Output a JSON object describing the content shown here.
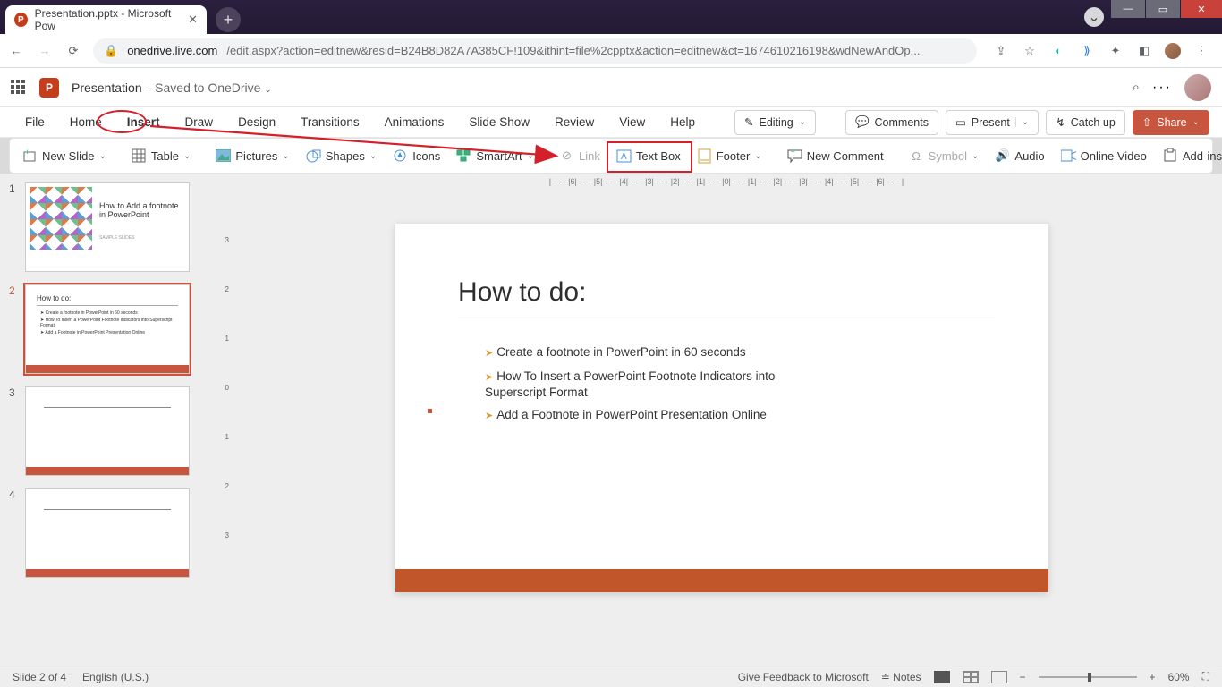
{
  "browser": {
    "tab_title": "Presentation.pptx - Microsoft Pow",
    "url_domain": "onedrive.live.com",
    "url_path": "/edit.aspx?action=editnew&resid=B24B8D82A7A385CF!109&ithint=file%2cpptx&action=editnew&ct=1674610216198&wdNewAndOp..."
  },
  "header": {
    "doc_name": "Presentation",
    "saved": "Saved to OneDrive"
  },
  "menu": {
    "items": [
      "File",
      "Home",
      "Insert",
      "Draw",
      "Design",
      "Transitions",
      "Animations",
      "Slide Show",
      "Review",
      "View",
      "Help"
    ],
    "editing": "Editing",
    "comments": "Comments",
    "present": "Present",
    "catchup": "Catch up",
    "share": "Share"
  },
  "ribbon": {
    "new_slide": "New Slide",
    "table": "Table",
    "pictures": "Pictures",
    "shapes": "Shapes",
    "icons": "Icons",
    "smartart": "SmartArt",
    "link": "Link",
    "textbox": "Text Box",
    "footer": "Footer",
    "new_comment": "New Comment",
    "symbol": "Symbol",
    "audio": "Audio",
    "online_video": "Online Video",
    "addins": "Add-ins"
  },
  "thumbs": {
    "t1_title": "How to Add a footnote in PowerPoint",
    "t1_sub": "SAMPLE SLIDES",
    "t2_title": "How to do:",
    "t2_b1": "Create a footnote in PowerPoint in 60 seconds",
    "t2_b2": "How To Insert a PowerPoint Footnote Indicators into Superscript Format",
    "t2_b3": "Add a Footnote in PowerPoint Presentation Online"
  },
  "slide": {
    "title": "How to do:",
    "bullets": [
      "Create a footnote in PowerPoint in 60 seconds",
      "How To Insert a PowerPoint Footnote Indicators into Superscript Format",
      "Add a Footnote in PowerPoint Presentation Online"
    ]
  },
  "status": {
    "slide": "Slide 2 of 4",
    "lang": "English (U.S.)",
    "feedback": "Give Feedback to Microsoft",
    "notes": "Notes",
    "zoom": "60%"
  },
  "annotation": {
    "highlighted_menu": "Insert",
    "highlighted_ribbon": "Text Box"
  }
}
